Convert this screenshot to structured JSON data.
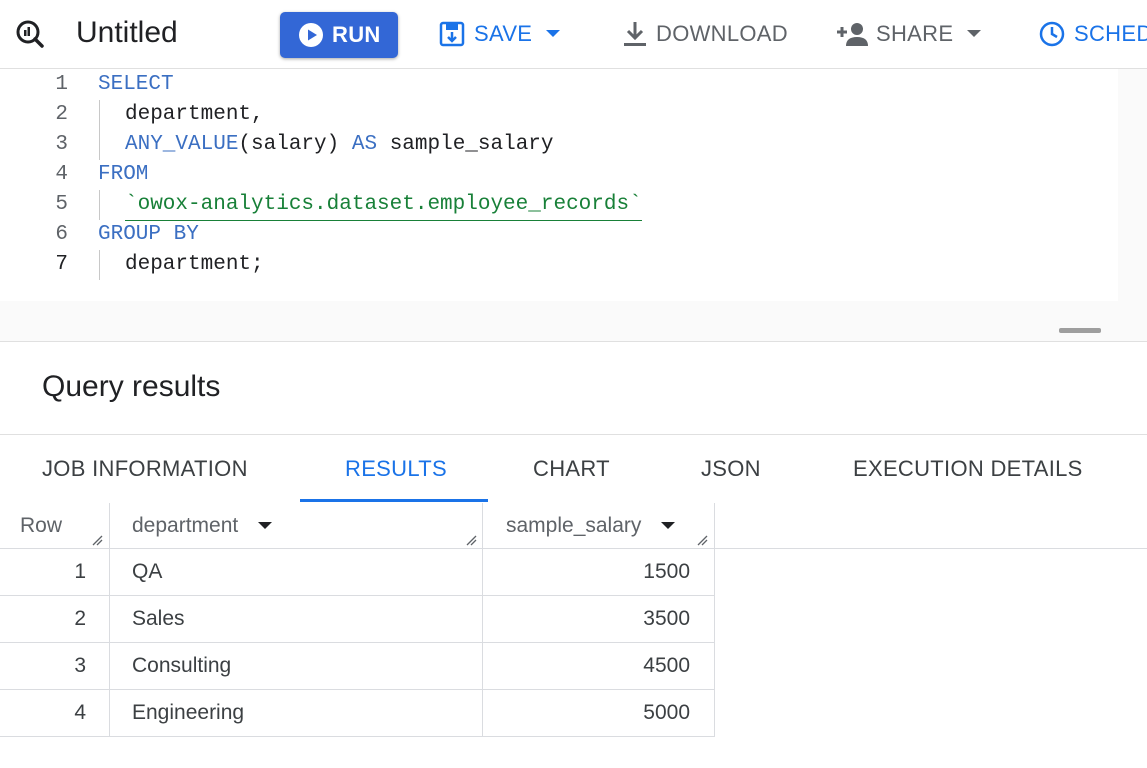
{
  "toolbar": {
    "title": "Untitled",
    "run_label": "RUN",
    "save_label": "SAVE",
    "download_label": "DOWNLOAD",
    "share_label": "SHARE",
    "schedule_label": "SCHED",
    "accent_color": "#1a73e8",
    "run_color": "#3367d6"
  },
  "editor": {
    "lines": [
      {
        "n": "1",
        "text": "SELECT"
      },
      {
        "n": "2",
        "text": "department,"
      },
      {
        "n": "3",
        "fn": "ANY_VALUE",
        "arg": "(salary)",
        "as": "AS",
        "alias": "sample_salary"
      },
      {
        "n": "4",
        "text": "FROM"
      },
      {
        "n": "5",
        "text": "`owox-analytics.dataset.employee_records`"
      },
      {
        "n": "6",
        "text": "GROUP BY"
      },
      {
        "n": "7",
        "text": "department;"
      }
    ]
  },
  "results": {
    "title": "Query results",
    "tabs": [
      {
        "label": "JOB INFORMATION"
      },
      {
        "label": "RESULTS",
        "active": true
      },
      {
        "label": "CHART"
      },
      {
        "label": "JSON"
      },
      {
        "label": "EXECUTION DETAILS"
      }
    ],
    "columns": [
      "Row",
      "department",
      "sample_salary"
    ],
    "rows": [
      {
        "row": "1",
        "department": "QA",
        "sample_salary": "1500"
      },
      {
        "row": "2",
        "department": "Sales",
        "sample_salary": "3500"
      },
      {
        "row": "3",
        "department": "Consulting",
        "sample_salary": "4500"
      },
      {
        "row": "4",
        "department": "Engineering",
        "sample_salary": "5000"
      }
    ]
  }
}
